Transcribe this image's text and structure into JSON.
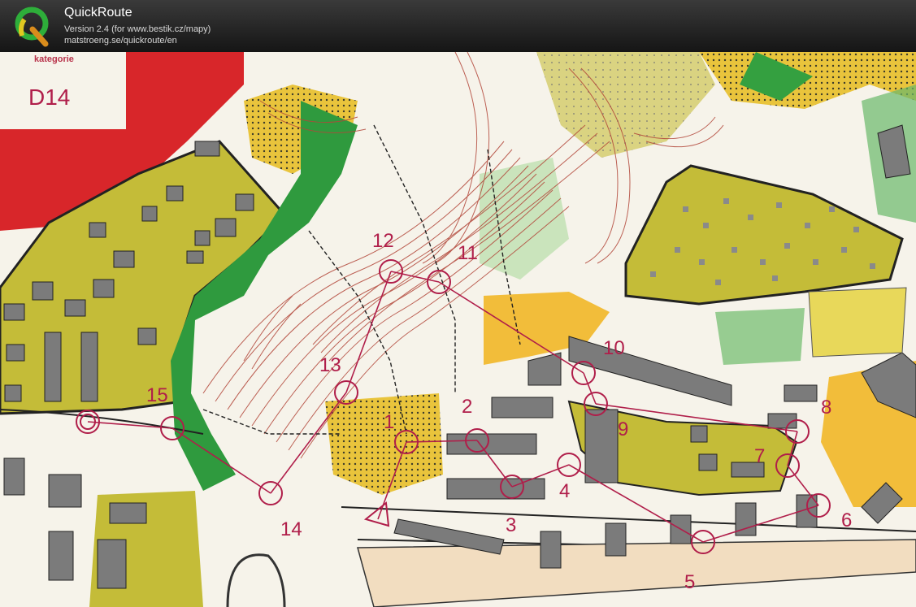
{
  "app": {
    "title": "QuickRoute",
    "version": "Version 2.4  (for www.bestik.cz/mapy)",
    "website": "matstroeng.se/quickroute/en"
  },
  "map": {
    "category_label": "kategorie",
    "category": "D14",
    "colors": {
      "course": "#b01e4a",
      "open_land": "#f5c24a",
      "rough_open": "#c9c13a",
      "forest_green": "#2f9a3e",
      "buildings": "#7a7a7a",
      "paper": "#f6f3ea"
    },
    "controls": [
      {
        "number": "1"
      },
      {
        "number": "2"
      },
      {
        "number": "3"
      },
      {
        "number": "4"
      },
      {
        "number": "5"
      },
      {
        "number": "6"
      },
      {
        "number": "7"
      },
      {
        "number": "8"
      },
      {
        "number": "9"
      },
      {
        "number": "10"
      },
      {
        "number": "11"
      },
      {
        "number": "12"
      },
      {
        "number": "13"
      },
      {
        "number": "14"
      },
      {
        "number": "15"
      }
    ]
  }
}
